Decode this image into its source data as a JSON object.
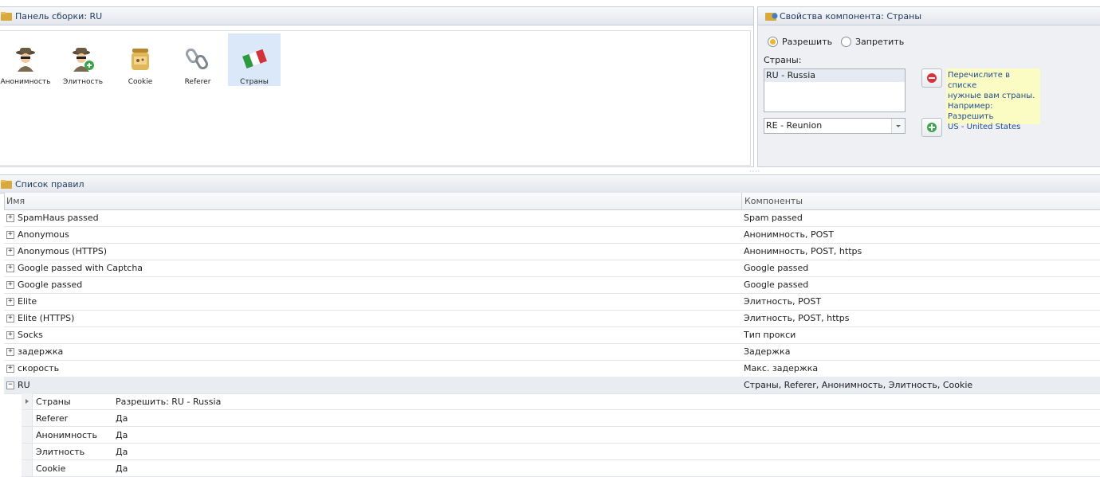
{
  "assembly_panel": {
    "title": "Панель сборки: RU",
    "tiles": [
      {
        "label": "Анонимность",
        "icon": "spy-agent-icon"
      },
      {
        "label": "Элитность",
        "icon": "spy-agent-add-icon"
      },
      {
        "label": "Cookie",
        "icon": "cookie-jar-icon"
      },
      {
        "label": "Referer",
        "icon": "chain-link-icon"
      },
      {
        "label": "Страны",
        "icon": "flag-icon"
      }
    ]
  },
  "properties_panel": {
    "title": "Свойства компонента: Страны",
    "radio_allow": "Разрешить",
    "radio_deny": "Запретить",
    "selected_radio": "Разрешить",
    "countries_label": "Страны:",
    "countries_list": [
      "RU - Russia"
    ],
    "country_select_value": "RE - Reunion",
    "hint_lines": [
      "Перечислите в списке",
      "нужные вам страны.",
      "Например:",
      "Разрешить",
      "US - United States"
    ]
  },
  "rules_panel": {
    "title": "Список правил",
    "columns": {
      "name": "Имя",
      "components": "Компоненты"
    },
    "rows": [
      {
        "name": "SpamHaus passed",
        "components": "Spam passed"
      },
      {
        "name": "Anonymous",
        "components": "Анонимность, POST"
      },
      {
        "name": "Anonymous (HTTPS)",
        "components": "Анонимность, POST, https"
      },
      {
        "name": "Google passed with Captcha",
        "components": "Google passed"
      },
      {
        "name": "Google passed",
        "components": "Google passed"
      },
      {
        "name": "Elite",
        "components": "Элитность, POST"
      },
      {
        "name": "Elite (HTTPS)",
        "components": "Элитность, POST, https"
      },
      {
        "name": "Socks",
        "components": "Тип прокси"
      },
      {
        "name": "задержка",
        "components": "Задержка"
      },
      {
        "name": "скорость",
        "components": "Макс. задержка"
      },
      {
        "name": "RU",
        "components": "Страны, Referer, Анонимность, Элитность, Cookie"
      }
    ],
    "expanded_details": [
      {
        "key": "Страны",
        "value": "Разрешить: RU - Russia"
      },
      {
        "key": "Referer",
        "value": "Да"
      },
      {
        "key": "Анонимность",
        "value": "Да"
      },
      {
        "key": "Элитность",
        "value": "Да"
      },
      {
        "key": "Cookie",
        "value": "Да"
      }
    ]
  },
  "colors": {
    "selected_tile": "#dbe8fa",
    "hint_background": "#fbfbc4",
    "expanded_row": "#e9ecf1",
    "panel_header_text": "#1e3a5f"
  }
}
